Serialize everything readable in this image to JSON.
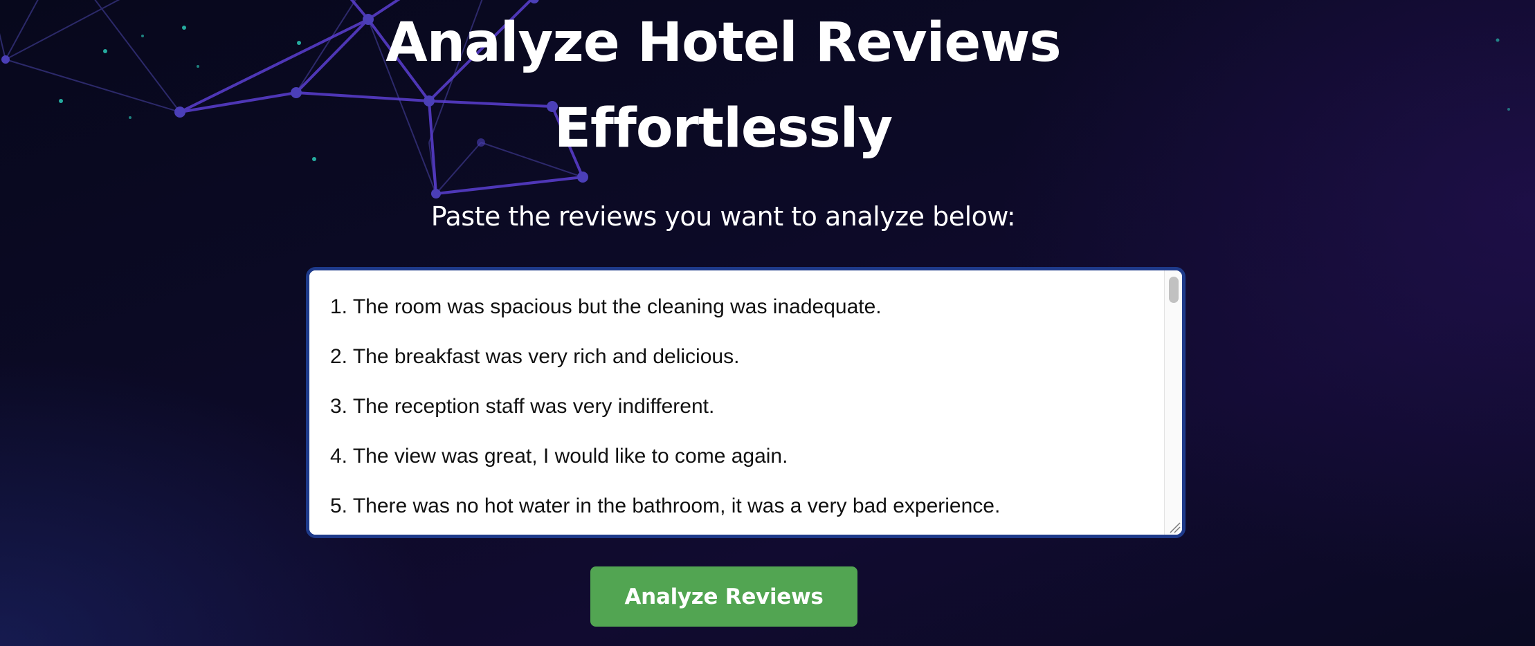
{
  "hero": {
    "title_line1": "Analyze Hotel Reviews",
    "title_line2": "Effortlessly",
    "subtitle": "Paste the reviews you want to analyze below:"
  },
  "reviews_input": {
    "value": "1. The room was spacious but the cleaning was inadequate.\n2. The breakfast was very rich and delicious.\n3. The reception staff was very indifferent.\n4. The view was great, I would like to come again.\n5. There was no hot water in the bathroom, it was a very bad experience."
  },
  "actions": {
    "analyze_label": "Analyze Reviews"
  },
  "colors": {
    "background": "#0c0a26",
    "accent_button": "#52a552",
    "input_border": "#1e3a8a",
    "network_lines": "#5b3fd1",
    "network_dots": "#2dd4bf"
  },
  "icons": {
    "background_decoration": "network-graph-icon",
    "textarea_resize": "resize-grip-icon"
  }
}
